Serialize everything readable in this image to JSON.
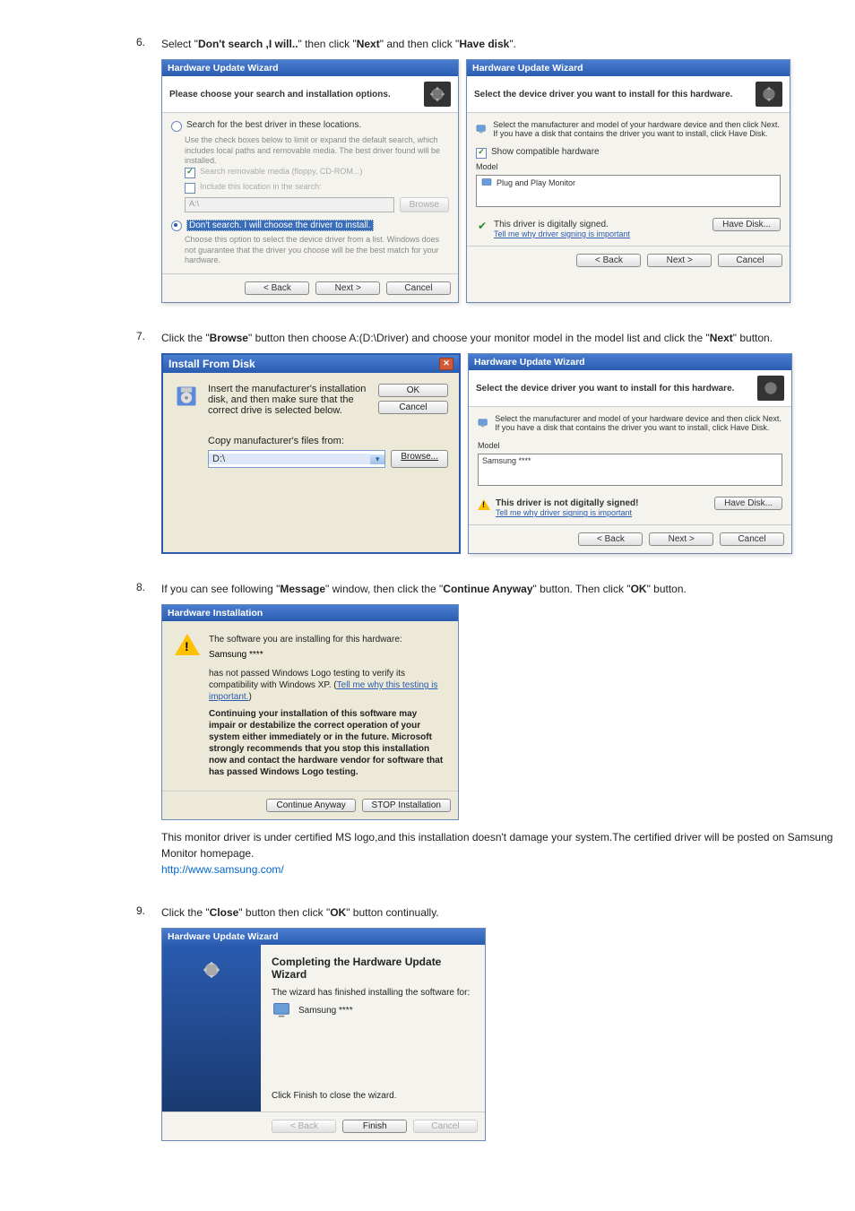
{
  "steps": {
    "s6": {
      "num": "6.",
      "line_a": "Select \"",
      "bold_a": "Don't search ,I will..",
      "line_b": "\" then click \"",
      "bold_b": "Next",
      "line_c": "\" and then click \"",
      "bold_c": "Have disk",
      "line_d": "\"."
    },
    "s7": {
      "num": "7.",
      "line_a": "Click the \"",
      "bold_a": "Browse",
      "line_b": "\" button then choose A:(D:\\Driver) and choose your monitor model in the model list and click the \"",
      "bold_b": "Next",
      "line_c": "\" button."
    },
    "s8": {
      "num": "8.",
      "line_a": "If you can see following \"",
      "bold_a": "Message",
      "line_b": "\" window, then click the \"",
      "bold_b": "Continue Anyway",
      "line_c": "\" button. Then click \"",
      "bold_c": "OK",
      "line_d": "\" button."
    },
    "s8_note": {
      "para": "This monitor driver is under certified MS logo,and this installation doesn't damage your system.The certified driver will be posted on Samsung Monitor homepage.",
      "link": "http://www.samsung.com/"
    },
    "s9": {
      "num": "9.",
      "line_a": "Click the \"",
      "bold_a": "Close",
      "line_b": "\" button then click \"",
      "bold_b": "OK",
      "line_c": "\" button continually."
    }
  },
  "dlg6a": {
    "title": "Hardware Update Wizard",
    "header": "Please choose your search and installation options.",
    "opt1": "Search for the best driver in these locations.",
    "opt1_sub": "Use the check boxes below to limit or expand the default search, which includes local paths and removable media. The best driver found will be installed.",
    "chk1": "Search removable media (floppy, CD-ROM...)",
    "chk2": "Include this location in the search:",
    "path": "A:\\",
    "browse": "Browse",
    "opt2": "Don't search. I will choose the driver to install.",
    "opt2_sub": "Choose this option to select the device driver from a list. Windows does not guarantee that the driver you choose will be the best match for your hardware.",
    "back": "< Back",
    "next": "Next >",
    "cancel": "Cancel"
  },
  "dlg6b": {
    "title": "Hardware Update Wizard",
    "header": "Select the device driver you want to install for this hardware.",
    "instr": "Select the manufacturer and model of your hardware device and then click Next. If you have a disk that contains the driver you want to install, click Have Disk.",
    "chk": "Show compatible hardware",
    "model_lbl": "Model",
    "model_item": "Plug and Play Monitor",
    "sign": "This driver is digitally signed.",
    "sign_link": "Tell me why driver signing is important",
    "have_disk": "Have Disk...",
    "back": "< Back",
    "next": "Next >",
    "cancel": "Cancel"
  },
  "dlg7a": {
    "title": "Install From Disk",
    "instr": "Insert the manufacturer's installation disk, and then make sure that the correct drive is selected below.",
    "ok": "OK",
    "cancel": "Cancel",
    "copy_lbl": "Copy manufacturer's files from:",
    "path": "D:\\",
    "browse": "Browse..."
  },
  "dlg7b": {
    "title": "Hardware Update Wizard",
    "header": "Select the device driver you want to install for this hardware.",
    "instr": "Select the manufacturer and model of your hardware device and then click Next. If you have a disk that contains the driver you want to install, click Have Disk.",
    "model_lbl": "Model",
    "model_item": "Samsung ****",
    "sign": "This driver is not digitally signed!",
    "sign_link": "Tell me why driver signing is important",
    "have_disk": "Have Disk...",
    "back": "< Back",
    "next": "Next >",
    "cancel": "Cancel"
  },
  "dlg8": {
    "title": "Hardware Installation",
    "l1": "The software you are installing for this hardware:",
    "prod": "Samsung ****",
    "l2a": "has not passed Windows Logo testing to verify its compatibility with Windows XP. (",
    "l2_link": "Tell me why this testing is important.",
    "l2b": ")",
    "bold": "Continuing your installation of this software may impair or destabilize the correct operation of your system either immediately or in the future. Microsoft strongly recommends that you stop this installation now and contact the hardware vendor for software that has passed Windows Logo testing.",
    "cont": "Continue Anyway",
    "stop": "STOP Installation"
  },
  "dlg9": {
    "title": "Hardware Update Wizard",
    "h": "Completing the Hardware Update Wizard",
    "l1": "The wizard has finished installing the software for:",
    "prod": "Samsung ****",
    "l2": "Click Finish to close the wizard.",
    "back": "< Back",
    "finish": "Finish",
    "cancel": "Cancel"
  }
}
